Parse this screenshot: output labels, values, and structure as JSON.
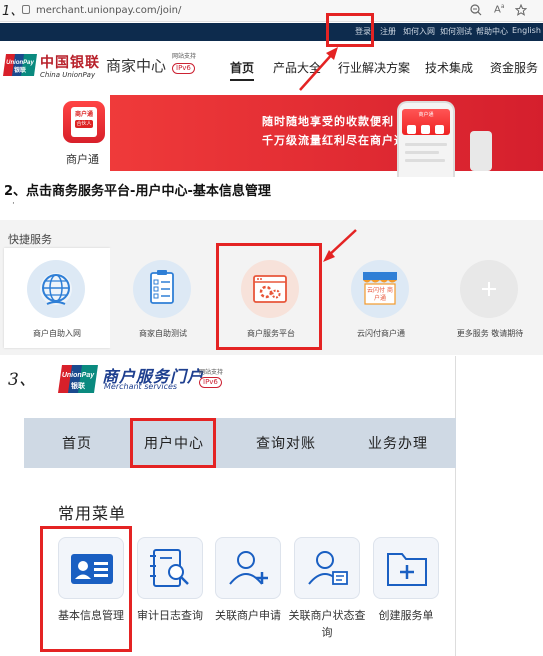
{
  "browser": {
    "step_marker": "1、",
    "url": "merchant.unionpay.com/join/",
    "zoom_icon": "zoom-out-icon",
    "read_icon": "read-aloud-icon",
    "fav_icon": "star-icon"
  },
  "topbar": {
    "links": [
      "登录",
      "注册",
      "如何入网",
      "如何测试",
      "帮助中心",
      "English"
    ]
  },
  "header": {
    "brand_cn": "中国银联",
    "brand_en": "China UnionPay",
    "site_name": "商家中心",
    "ipv6_note": "网站支持",
    "ipv6_badge": "IPv6",
    "nav": [
      "首页",
      "产品大全",
      "行业解决方案",
      "技术集成",
      "资金服务"
    ],
    "active_nav": "首页"
  },
  "banner": {
    "app_icon_top": "商户通",
    "app_icon_badge": "合伙人",
    "app_label": "商户通",
    "line1": "随时随地享受的收款便利",
    "line2": "千万级流量红利尽在商户通",
    "phone_title": "商户通"
  },
  "step2": {
    "text": "2、点击商务服务平台-用户中心-基本信息管理",
    "dot": "·"
  },
  "quick_services": {
    "title": "快捷服务",
    "items": [
      {
        "label": "商户自助入网",
        "icon": "globe-icon"
      },
      {
        "label": "商家自助测试",
        "icon": "checklist-icon"
      },
      {
        "label": "商户服务平台",
        "icon": "browser-gear-icon"
      },
      {
        "label": "云闪付商户通",
        "icon": "storefront-icon",
        "icon_text": "云闪付 商户通"
      },
      {
        "label": "更多服务 敬请期待",
        "icon": "plus-icon"
      }
    ]
  },
  "portal": {
    "step_marker": "3、",
    "title": "商户服务门户",
    "subtitle": "Merchant services",
    "ipv6_note": "网站支持",
    "ipv6_badge": "IPv6",
    "nav": [
      "首页",
      "用户中心",
      "查询对账",
      "业务办理"
    ],
    "common_menu_title": "常用菜单",
    "menu": [
      {
        "label": "基本信息管理",
        "icon": "id-card-icon"
      },
      {
        "label": "审计日志查询",
        "icon": "log-search-icon"
      },
      {
        "label": "关联商户申请",
        "icon": "user-add-icon"
      },
      {
        "label": "关联商户状态查询",
        "icon": "user-status-icon"
      },
      {
        "label": "创建服务单",
        "icon": "folder-add-icon"
      }
    ]
  },
  "colors": {
    "annotation_red": "#e42323",
    "brand_red": "#d51f2d",
    "portal_blue": "#1e3f8f",
    "topbar_navy": "#0d2b4d"
  }
}
